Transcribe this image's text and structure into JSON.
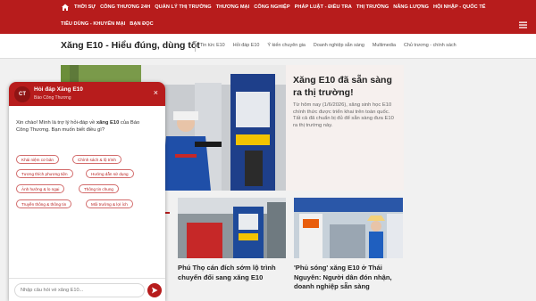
{
  "topnav": {
    "row1": [
      "THỜI SỰ",
      "CÔNG THƯƠNG 24H",
      "QUẢN LÝ THỊ TRƯỜNG",
      "THƯƠNG MẠI",
      "CÔNG NGHIỆP",
      "PHÁP LUẬT - ĐIỀU TRA",
      "THỊ TRƯỜNG",
      "NĂNG LƯỢNG",
      "HỘI NHẬP - QUỐC TẾ"
    ],
    "row2": [
      "TIÊU DÙNG - KHUYẾN MẠI",
      "BẠN ĐỌC"
    ],
    "home_icon": "home-icon",
    "menu_icon": "hamburger-menu-icon"
  },
  "subnav": {
    "brand": "Xăng E10 - Hiểu đúng, dùng tốt",
    "tabs": [
      "Tin tức E10",
      "Hỏi đáp E10",
      "Ý kiến chuyên gia",
      "Doanh nghiệp sẵn sàng",
      "Multimedia",
      "Chủ trương - chính sách"
    ]
  },
  "hero": {
    "title": "Xăng E10 đã sẵn sàng ra thị trường!",
    "description": "Từ hôm nay (1/6/2026), xăng sinh học E10 chính thức được triển khai trên toàn quốc. Tất cả đã chuẩn bị đủ để sẵn sàng đưa E10 ra thị trường này."
  },
  "cards": [
    {
      "title": "Phú Thọ cán đích sớm lộ trình chuyển đổi sang xăng E10"
    },
    {
      "title": "'Phủ sóng' xăng E10 ở Thái Nguyên: Người dân đón nhận, doanh nghiệp sẵn sàng"
    }
  ],
  "chat": {
    "avatar": "CT",
    "title": "Hỏi đáp Xăng E10",
    "subtitle": "Báo Công Thương",
    "close": "×",
    "greeting": "Xin chào! Mình là trợ lý hỏi-đáp về xăng E10 của Báo Công Thương. Bạn muốn biết điều gì?",
    "greeting_bold": "xăng E10",
    "chips": [
      "Khái niệm cơ bản",
      "Chính sách & lộ trình",
      "Tương thích phương tiện",
      "Hướng dẫn sử dụng",
      "Ảnh hưởng & lo ngại",
      "Thông tin chung",
      "Truyền thông & thông tin",
      "Môi trường & lợi ích"
    ],
    "input_placeholder": "Nhập câu hỏi về xăng E10...",
    "send_icon": "send-icon"
  },
  "colors": {
    "brand_red": "#b71c1c",
    "hero_bg": "#f6f0ee"
  }
}
